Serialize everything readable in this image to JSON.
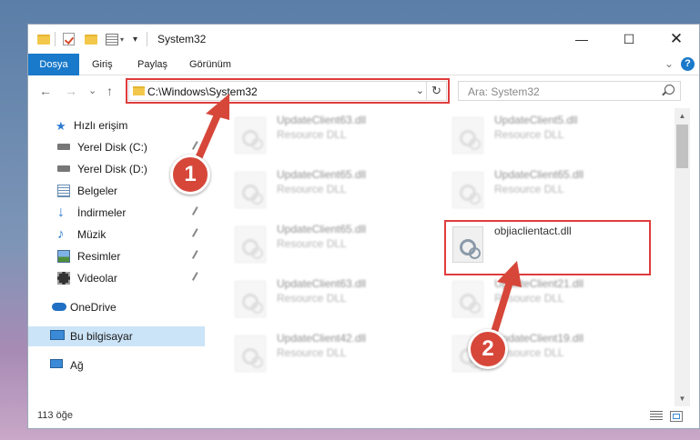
{
  "window": {
    "title": "System32"
  },
  "ribbon": {
    "tabs": [
      "Dosya",
      "Giriş",
      "Paylaş",
      "Görünüm"
    ],
    "help_label": "?"
  },
  "navbar": {
    "back": "←",
    "forward": "→",
    "recent": "⌄",
    "up": "↑",
    "address": "C:\\Windows\\System32",
    "search_placeholder": "Ara: System32"
  },
  "sidebar": {
    "items": [
      {
        "label": "Hızlı erişim",
        "icon": "star-icon"
      },
      {
        "label": "Yerel Disk (C:)",
        "icon": "drive-icon"
      },
      {
        "label": "Yerel Disk (D:)",
        "icon": "drive-icon"
      },
      {
        "label": "Belgeler",
        "icon": "documents-icon"
      },
      {
        "label": "İndirmeler",
        "icon": "download-icon"
      },
      {
        "label": "Müzik",
        "icon": "music-icon"
      },
      {
        "label": "Resimler",
        "icon": "pictures-icon"
      },
      {
        "label": "Videolar",
        "icon": "video-icon"
      },
      {
        "label": "OneDrive",
        "icon": "cloud-icon"
      },
      {
        "label": "Bu bilgisayar",
        "icon": "computer-icon"
      },
      {
        "label": "Ağ",
        "icon": "network-icon"
      }
    ]
  },
  "files": [
    {
      "name": "UpdateClient63.dll",
      "type": "Resource DLL"
    },
    {
      "name": "UpdateClient5.dll",
      "type": "Resource DLL"
    },
    {
      "name": "UpdateClient65.dll",
      "type": "Resource DLL"
    },
    {
      "name": "UpdateClient65.dll",
      "type": "Resource DLL"
    },
    {
      "name": "UpdateClient65.dll",
      "type": "Resource DLL"
    },
    {
      "name": "objiaclientact.dll",
      "type": ""
    },
    {
      "name": "UpdateClient63.dll",
      "type": "Resource DLL"
    },
    {
      "name": "UpdateClient21.dll",
      "type": "Resource DLL"
    },
    {
      "name": "UpdateClient42.dll",
      "type": "Resource DLL"
    },
    {
      "name": "UpdateClient19.dll",
      "type": "Resource DLL"
    }
  ],
  "status": {
    "count": "113 öğe"
  },
  "annotations": {
    "step1": "1",
    "step2": "2",
    "color": "#e03c3c"
  }
}
